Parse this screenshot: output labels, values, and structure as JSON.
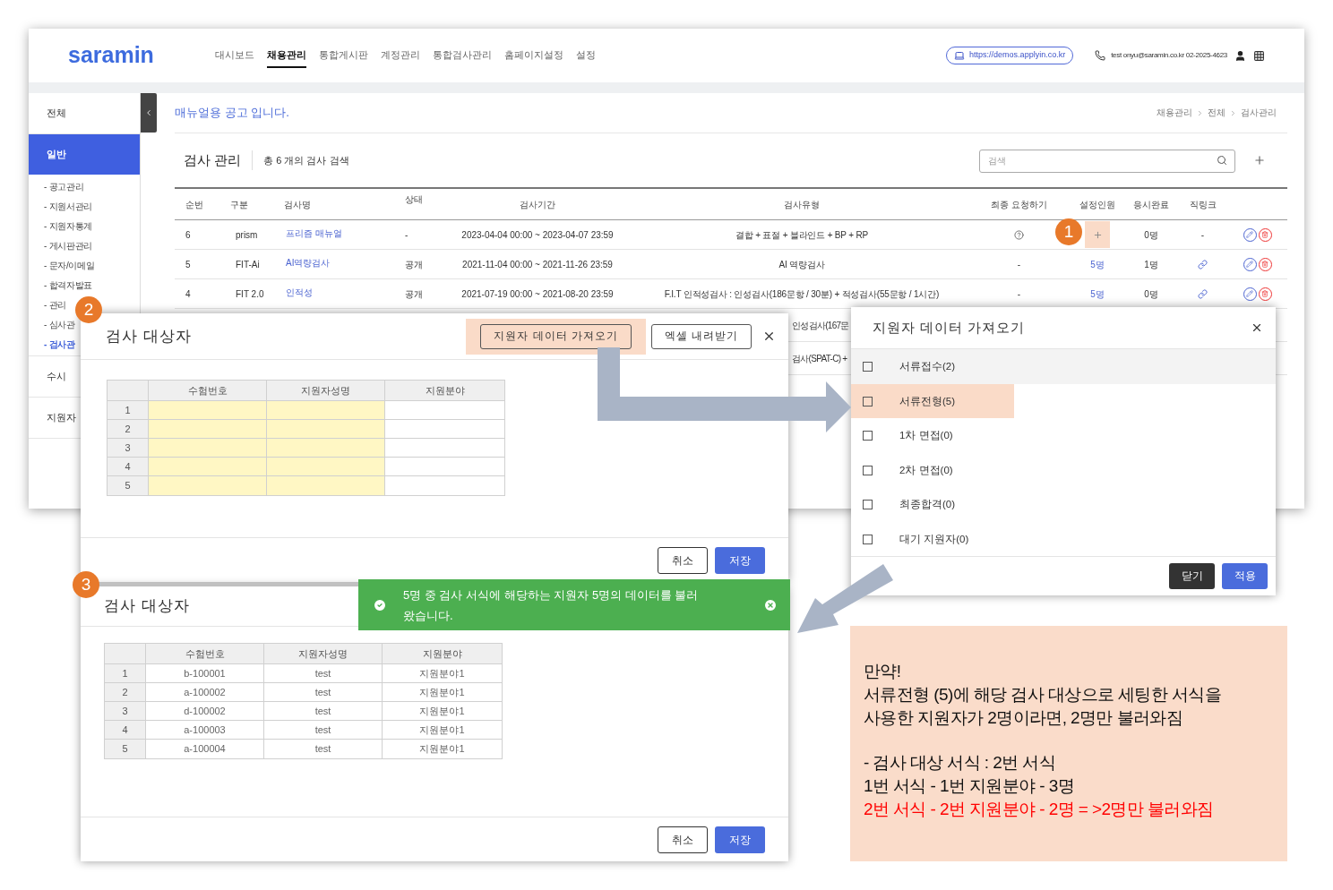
{
  "app": {
    "logo": "saramin",
    "nav": [
      {
        "label": "대시보드",
        "selected": false
      },
      {
        "label": "채용관리",
        "selected": true
      },
      {
        "label": "통합게시판",
        "selected": false
      },
      {
        "label": "계정관리",
        "selected": false
      },
      {
        "label": "통합검사관리",
        "selected": false
      },
      {
        "label": "홈페이지설정",
        "selected": false
      },
      {
        "label": "설정",
        "selected": false
      }
    ],
    "site_url": "https://demos.applyin.co.kr",
    "contact": "test onyu@saramin.co.kr 02-2025-4623",
    "sidebar": [
      {
        "label": "전체",
        "selected": false
      },
      {
        "label": "일반",
        "selected": true,
        "children": [
          {
            "label": "- 공고관리",
            "selected": false
          },
          {
            "label": "- 지원서관리",
            "selected": false
          },
          {
            "label": "- 지원자통계",
            "selected": false
          },
          {
            "label": "- 게시판관리",
            "selected": false
          },
          {
            "label": "- 문자/이메일",
            "selected": false
          },
          {
            "label": "- 합격자발표",
            "selected": false
          },
          {
            "label": "- 관리",
            "selected": false
          },
          {
            "label": "- 심사관",
            "selected": false
          },
          {
            "label": "- 검사관",
            "selected": true
          }
        ]
      },
      {
        "label": "수시",
        "selected": false
      },
      {
        "label": "지원자",
        "selected": false
      }
    ],
    "notice": "매뉴얼용 공고 입니다.",
    "breadcrumb": [
      "채용관리",
      "전체",
      "검사관리"
    ],
    "title": "검사 관리",
    "count": "총 6 개의 검사 검색",
    "search": {
      "placeholder": "검색"
    },
    "columns": [
      "순번",
      "구분",
      "검사명",
      "상태",
      "검사기간",
      "검사유형",
      "최종 요청하기",
      "설정인원",
      "응시완료",
      "직링크"
    ],
    "rows": [
      {
        "no": "6",
        "category": "prism",
        "name": "프리즘 매뉴얼",
        "status": "-",
        "period": "2023-04-04 00:00 ~ 2023-04-07 23:59",
        "type": "결합 + 표절 + 블라인드 + BP + RP",
        "final_request": {
          "kind": "help"
        },
        "set_count": {
          "kind": "add",
          "highlighted": true
        },
        "completed": "0명",
        "direct_link": {
          "kind": "text",
          "text": "-"
        }
      },
      {
        "no": "5",
        "category": "FIT-Ai",
        "name": "AI역량검사",
        "status": "공개",
        "period": "2021-11-04 00:00 ~ 2021-11-26 23:59",
        "type": "AI 역량검사",
        "final_request": {
          "kind": "text",
          "text": "-"
        },
        "set_count": {
          "kind": "text",
          "text": "5명",
          "highlighted": false
        },
        "completed": "1명",
        "direct_link": {
          "kind": "link"
        }
      },
      {
        "no": "4",
        "category": "FIT 2.0",
        "name": "인적성",
        "status": "공개",
        "period": "2021-07-19 00:00 ~ 2021-08-20 23:59",
        "type": "F.I.T 인적성검사 : 인성검사(186문항 / 30분) + 적성검사(55문항 / 1시간)",
        "final_request": {
          "kind": "text",
          "text": "-"
        },
        "set_count": {
          "kind": "text",
          "text": "5명",
          "highlighted": false
        },
        "completed": "0명",
        "direct_link": {
          "kind": "link"
        }
      }
    ],
    "hidden_row_fragments": [
      "인성검사(167문",
      "검사(SPAT-C) +"
    ]
  },
  "target_dialog": {
    "title": "검사 대상자",
    "import_button": {
      "label": "지원자 데이터 가져오기",
      "highlighted": true
    },
    "excel_button": "엑셀 내려받기",
    "columns": [
      {
        "label": "수험번호",
        "required": true
      },
      {
        "label": "지원자성명",
        "required": true
      },
      {
        "label": "지원분야",
        "required": false
      }
    ],
    "rows": [
      {
        "no": "1",
        "cells": [
          "",
          "",
          ""
        ]
      },
      {
        "no": "2",
        "cells": [
          "",
          "",
          ""
        ]
      },
      {
        "no": "3",
        "cells": [
          "",
          "",
          ""
        ]
      },
      {
        "no": "4",
        "cells": [
          "",
          "",
          ""
        ]
      },
      {
        "no": "5",
        "cells": [
          "",
          "",
          ""
        ]
      }
    ],
    "buttons": [
      "취소",
      "저장"
    ]
  },
  "import_dialog": {
    "title": "지원자 데이터 가져오기",
    "options": [
      {
        "label": "서류접수(2)",
        "checked": false,
        "hovered": true,
        "highlighted": false
      },
      {
        "label": "서류전형(5)",
        "checked": false,
        "hovered": false,
        "highlighted": true
      },
      {
        "label": "1차 면접(0)",
        "checked": false,
        "hovered": false,
        "highlighted": false
      },
      {
        "label": "2차 면접(0)",
        "checked": false,
        "hovered": false,
        "highlighted": false
      },
      {
        "label": "최종합격(0)",
        "checked": false,
        "hovered": false,
        "highlighted": false
      },
      {
        "label": "대기 지원자(0)",
        "checked": false,
        "hovered": false,
        "highlighted": false
      }
    ],
    "close_button": "닫기",
    "apply_button": "적용"
  },
  "result_dialog": {
    "title": "검사 대상자",
    "toast": "5명 중 검사 서식에 해당하는 지원자 5명의 데이터를 불러 왔습니다.",
    "columns": [
      {
        "label": "수험번호",
        "required": false
      },
      {
        "label": "지원자성명",
        "required": false
      },
      {
        "label": "지원분야",
        "required": false
      }
    ],
    "rows": [
      {
        "no": "1",
        "cells": [
          "b-100001",
          "test",
          "지원분야1"
        ]
      },
      {
        "no": "2",
        "cells": [
          "a-100002",
          "test",
          "지원분야1"
        ]
      },
      {
        "no": "3",
        "cells": [
          "d-100002",
          "test",
          "지원분야1"
        ]
      },
      {
        "no": "4",
        "cells": [
          "a-100003",
          "test",
          "지원분야1"
        ]
      },
      {
        "no": "5",
        "cells": [
          "a-100004",
          "test",
          "지원분야1"
        ]
      }
    ],
    "buttons": [
      "취소",
      "저장"
    ]
  },
  "note": {
    "paragraphs": [
      [
        {
          "text": "만약!",
          "color": "#111111"
        },
        {
          "text": "서류전형 (5)에 해당 검사 대상으로 세팅한 서식을",
          "color": "#111111"
        },
        {
          "text": "사용한 지원자가 2명이라면, 2명만 불러와짐",
          "color": "#111111"
        }
      ],
      [
        {
          "text": "- 검사 대상 서식 : 2번 서식",
          "color": "#111111"
        },
        {
          "text": "1번 서식 - 1번 지원분야 - 3명",
          "color": "#111111"
        },
        {
          "text": "2번 서식 - 2번 지원분야 - 2명 = >2명만 불러와짐",
          "color": "#ff0000"
        }
      ]
    ]
  },
  "step_badges": [
    "1",
    "2",
    "3"
  ]
}
